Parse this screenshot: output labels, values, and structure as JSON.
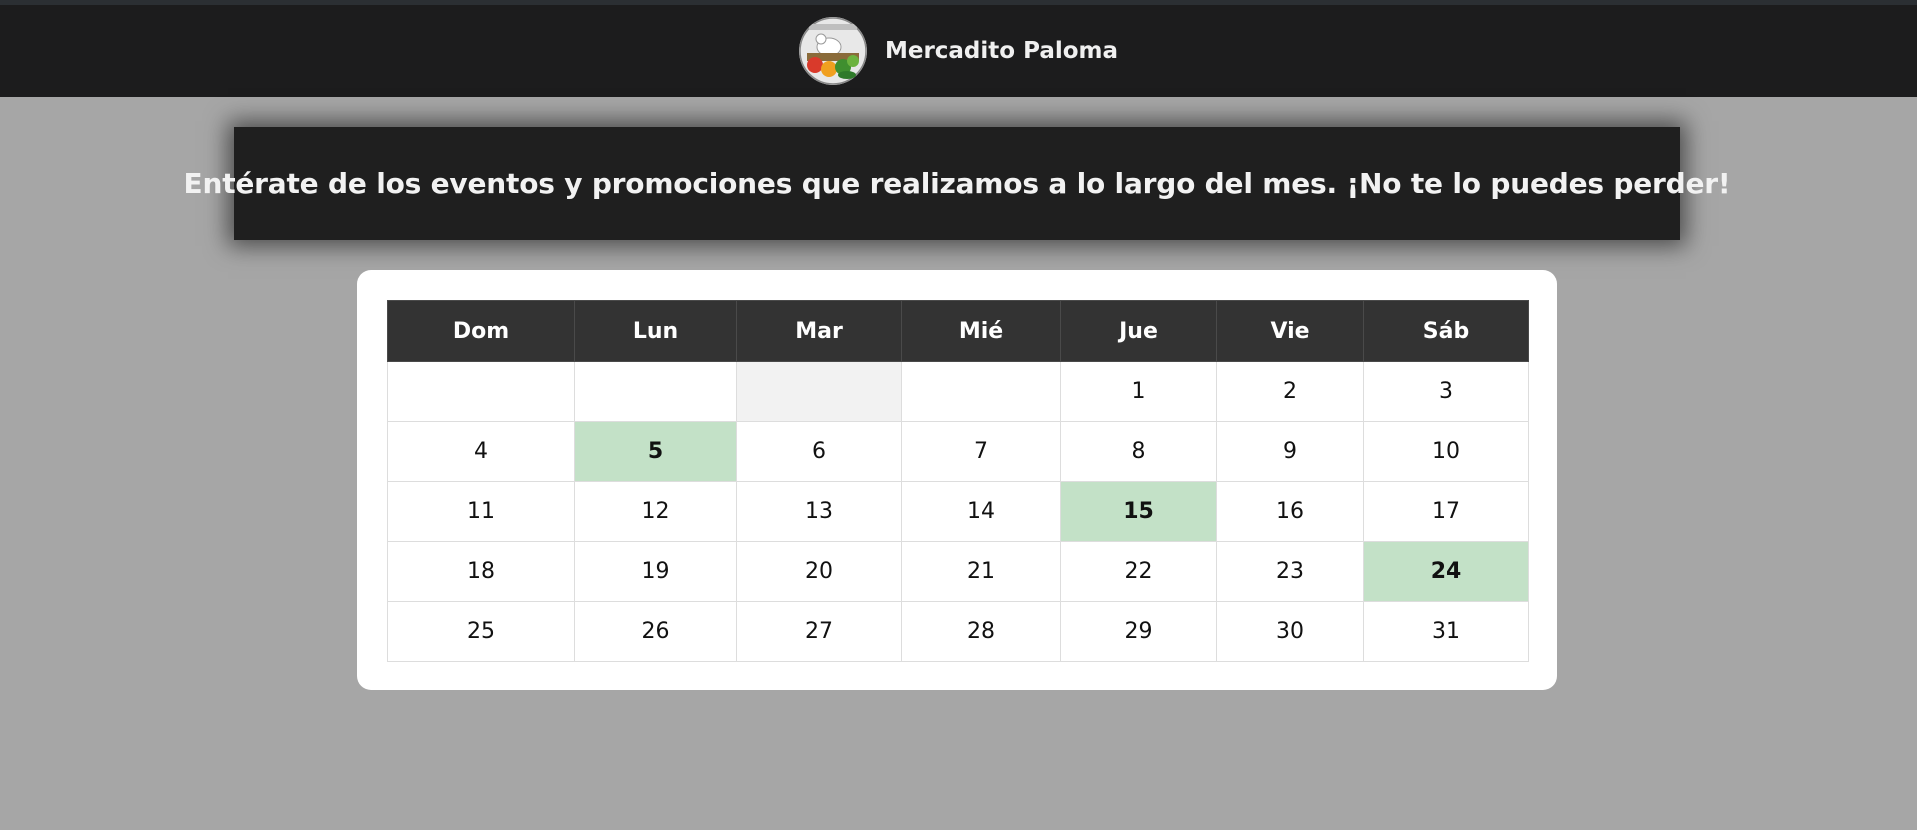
{
  "navbar": {
    "brand_name": "Mercadito Paloma",
    "logo_icon": "market-dove-logo-icon"
  },
  "banner": {
    "text": "Entérate de los eventos y promociones que realizamos a lo largo del mes. ¡No te lo puedes perder!"
  },
  "calendar": {
    "weekdays": [
      "Dom",
      "Lun",
      "Mar",
      "Mié",
      "Jue",
      "Vie",
      "Sáb"
    ],
    "weeks": [
      [
        "",
        "",
        "",
        "",
        "1",
        "2",
        "3"
      ],
      [
        "4",
        "5",
        "6",
        "7",
        "8",
        "9",
        "10"
      ],
      [
        "11",
        "12",
        "13",
        "14",
        "15",
        "16",
        "17"
      ],
      [
        "18",
        "19",
        "20",
        "21",
        "22",
        "23",
        "24"
      ],
      [
        "25",
        "26",
        "27",
        "28",
        "29",
        "30",
        "31"
      ]
    ],
    "event_days": [
      "5",
      "15",
      "24"
    ],
    "colors": {
      "event_bg": "#c3e1c7",
      "event_text": "#1aa11a",
      "header_bg": "#333333"
    }
  }
}
